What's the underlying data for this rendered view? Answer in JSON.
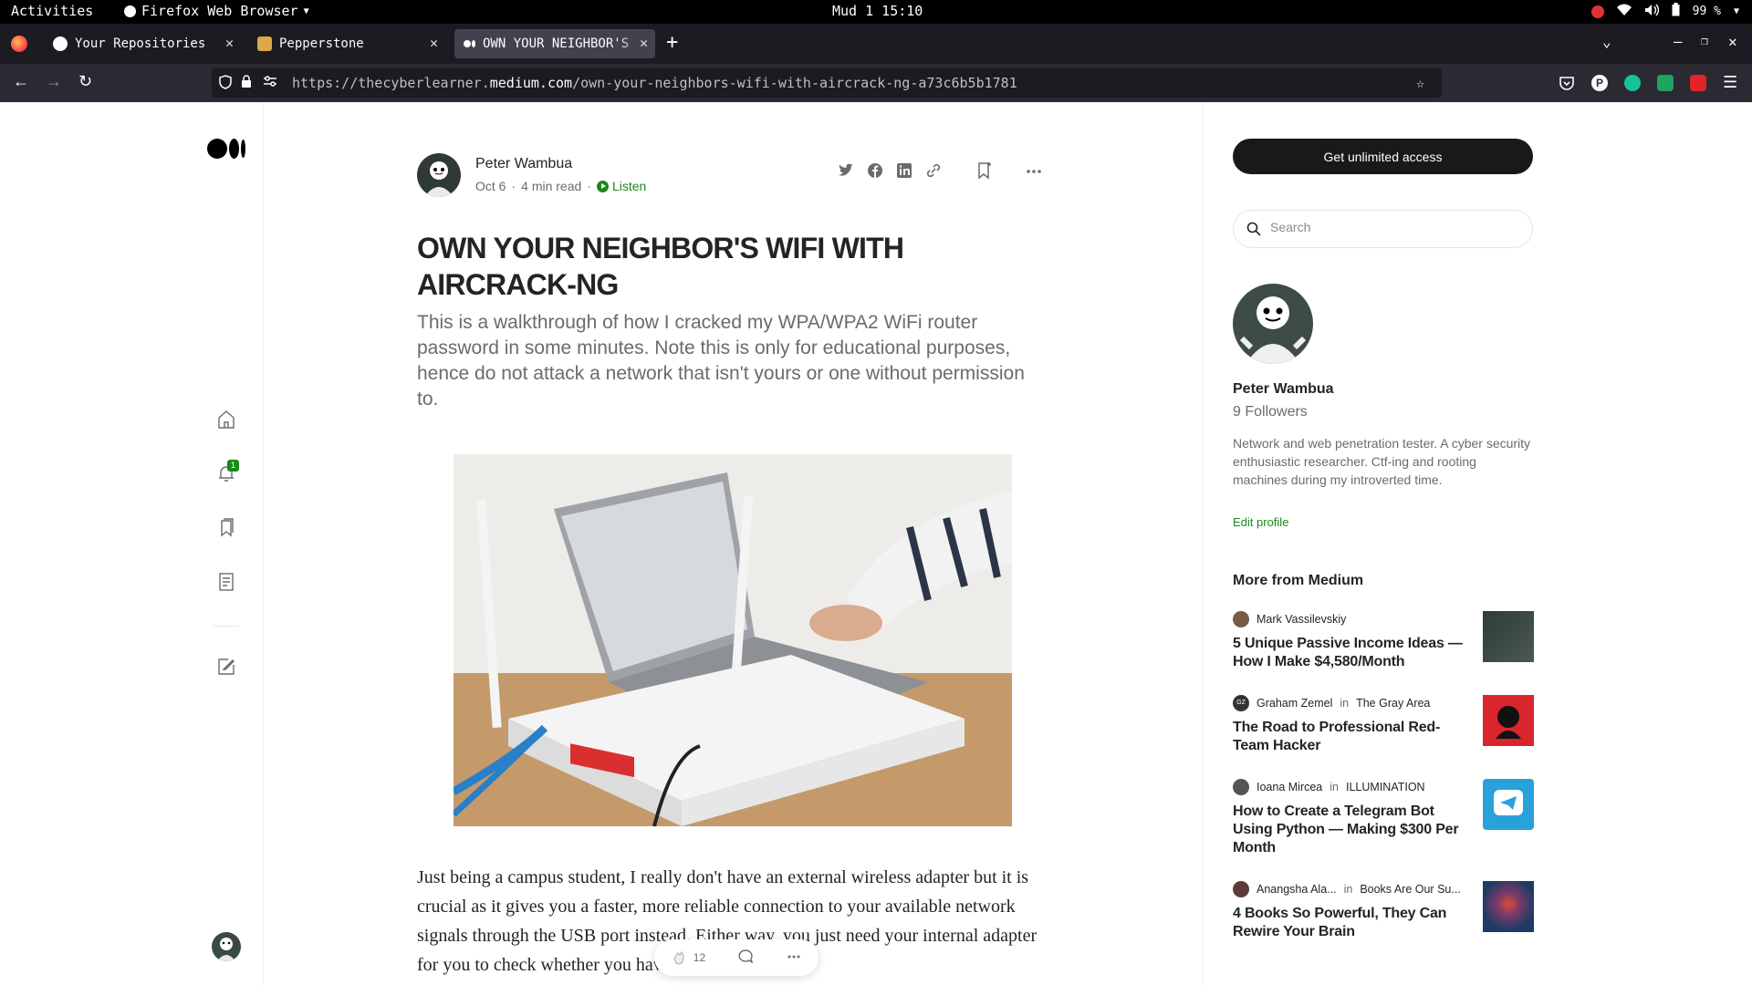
{
  "topbar": {
    "activities": "Activities",
    "app_name": "Firefox Web Browser",
    "clock": "Mud 1 15:10",
    "battery": "99 %"
  },
  "tabs": [
    {
      "label": "Your Repositories",
      "icon": "github-icon",
      "active": false
    },
    {
      "label": "Pepperstone",
      "icon": "pepperstone-icon",
      "active": false
    },
    {
      "label": "OWN YOUR NEIGHBOR'S",
      "icon": "medium-icon",
      "active": true
    }
  ],
  "url": {
    "prefix": "https://thecyberlearner.",
    "domain": "medium.com",
    "path": "/own-your-neighbors-wifi-with-aircrack-ng-a73c6b5b1781"
  },
  "leftnav": {
    "notification_count": "1"
  },
  "article": {
    "author": "Peter Wambua",
    "date": "Oct 6",
    "read_time": "4 min read",
    "listen": "Listen",
    "title": "OWN YOUR NEIGHBOR'S WIFI WITH AIRCRACK-NG",
    "subtitle": "This is a walkthrough of how I cracked my WPA/WPA2 WiFi router password in some minutes. Note this is only for educational purposes, hence do not attack a network that isn't yours or one without permission to.",
    "body": "Just being a campus student, I really don't have an external wireless adapter but it is crucial as it gives you a faster, more reliable connection to your available network signals through the USB port instead. Either way, you just need your internal adapter for you to check whether you have(after",
    "claps": "12"
  },
  "sidebar": {
    "get_access": "Get unlimited access",
    "search_placeholder": "Search",
    "profile_name": "Peter Wambua",
    "followers": "9 Followers",
    "bio": "Network and web penetration tester. A cyber security enthusiastic researcher. Ctf-ing and rooting machines during my introverted time.",
    "edit_profile": "Edit profile",
    "more_title": "More from Medium",
    "recommendations": [
      {
        "author": "Mark Vassilevskiy",
        "in": "",
        "publication": "",
        "title": "5 Unique Passive Income Ideas — How I Make $4,580/Month"
      },
      {
        "author": "Graham Zemel",
        "in": "in",
        "publication": "The Gray Area",
        "title": "The Road to Professional Red-Team Hacker"
      },
      {
        "author": "Ioana Mircea",
        "in": "in",
        "publication": "ILLUMINATION",
        "title": "How to Create a Telegram Bot Using Python — Making $300 Per Month"
      },
      {
        "author": "Anangsha Ala...",
        "in": "in",
        "publication": "Books Are Our Su...",
        "title": "4 Books So Powerful, They Can Rewire Your Brain"
      }
    ]
  },
  "colors": {
    "medium_green": "#1a8917",
    "text": "#242424",
    "muted": "#6b6b6b"
  }
}
